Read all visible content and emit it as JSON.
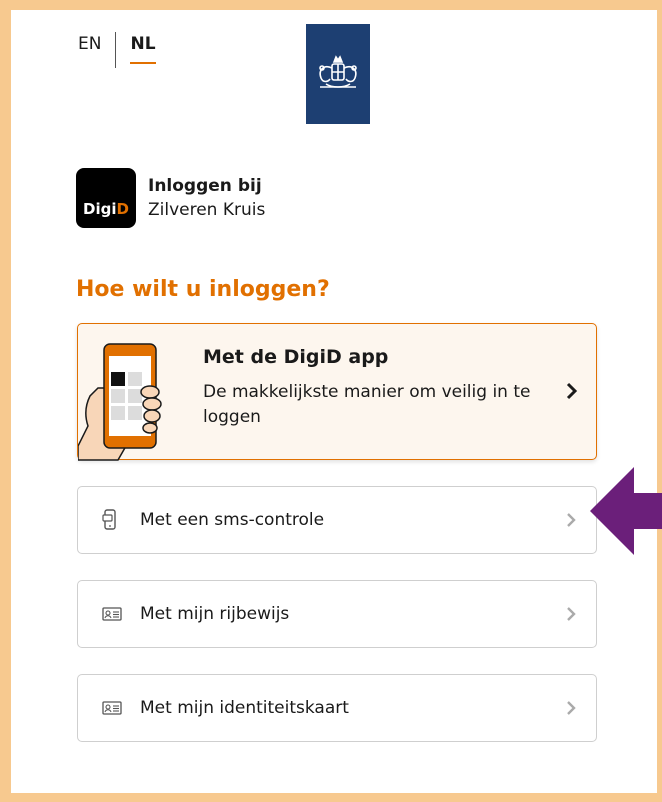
{
  "language": {
    "en_label": "EN",
    "nl_label": "NL",
    "selected": "NL"
  },
  "brand": {
    "logo_text_1": "Digi",
    "logo_text_2": "D",
    "title": "Inloggen bij",
    "subtitle": "Zilveren Kruis"
  },
  "heading": "Hoe wilt u inloggen?",
  "app_option": {
    "title": "Met de DigiD app",
    "description": "De makkelijkste manier om veilig in te loggen"
  },
  "options": [
    {
      "label": "Met een sms-controle",
      "icon": "phone-sms-icon"
    },
    {
      "label": "Met mijn rijbewijs",
      "icon": "id-card-icon"
    },
    {
      "label": "Met mijn identiteitskaart",
      "icon": "id-card-icon"
    }
  ],
  "colors": {
    "accent": "#e17000",
    "logo_bg": "#1d3f72",
    "border_frame": "#f7c98f",
    "annotation_arrow": "#6b1f7a"
  }
}
